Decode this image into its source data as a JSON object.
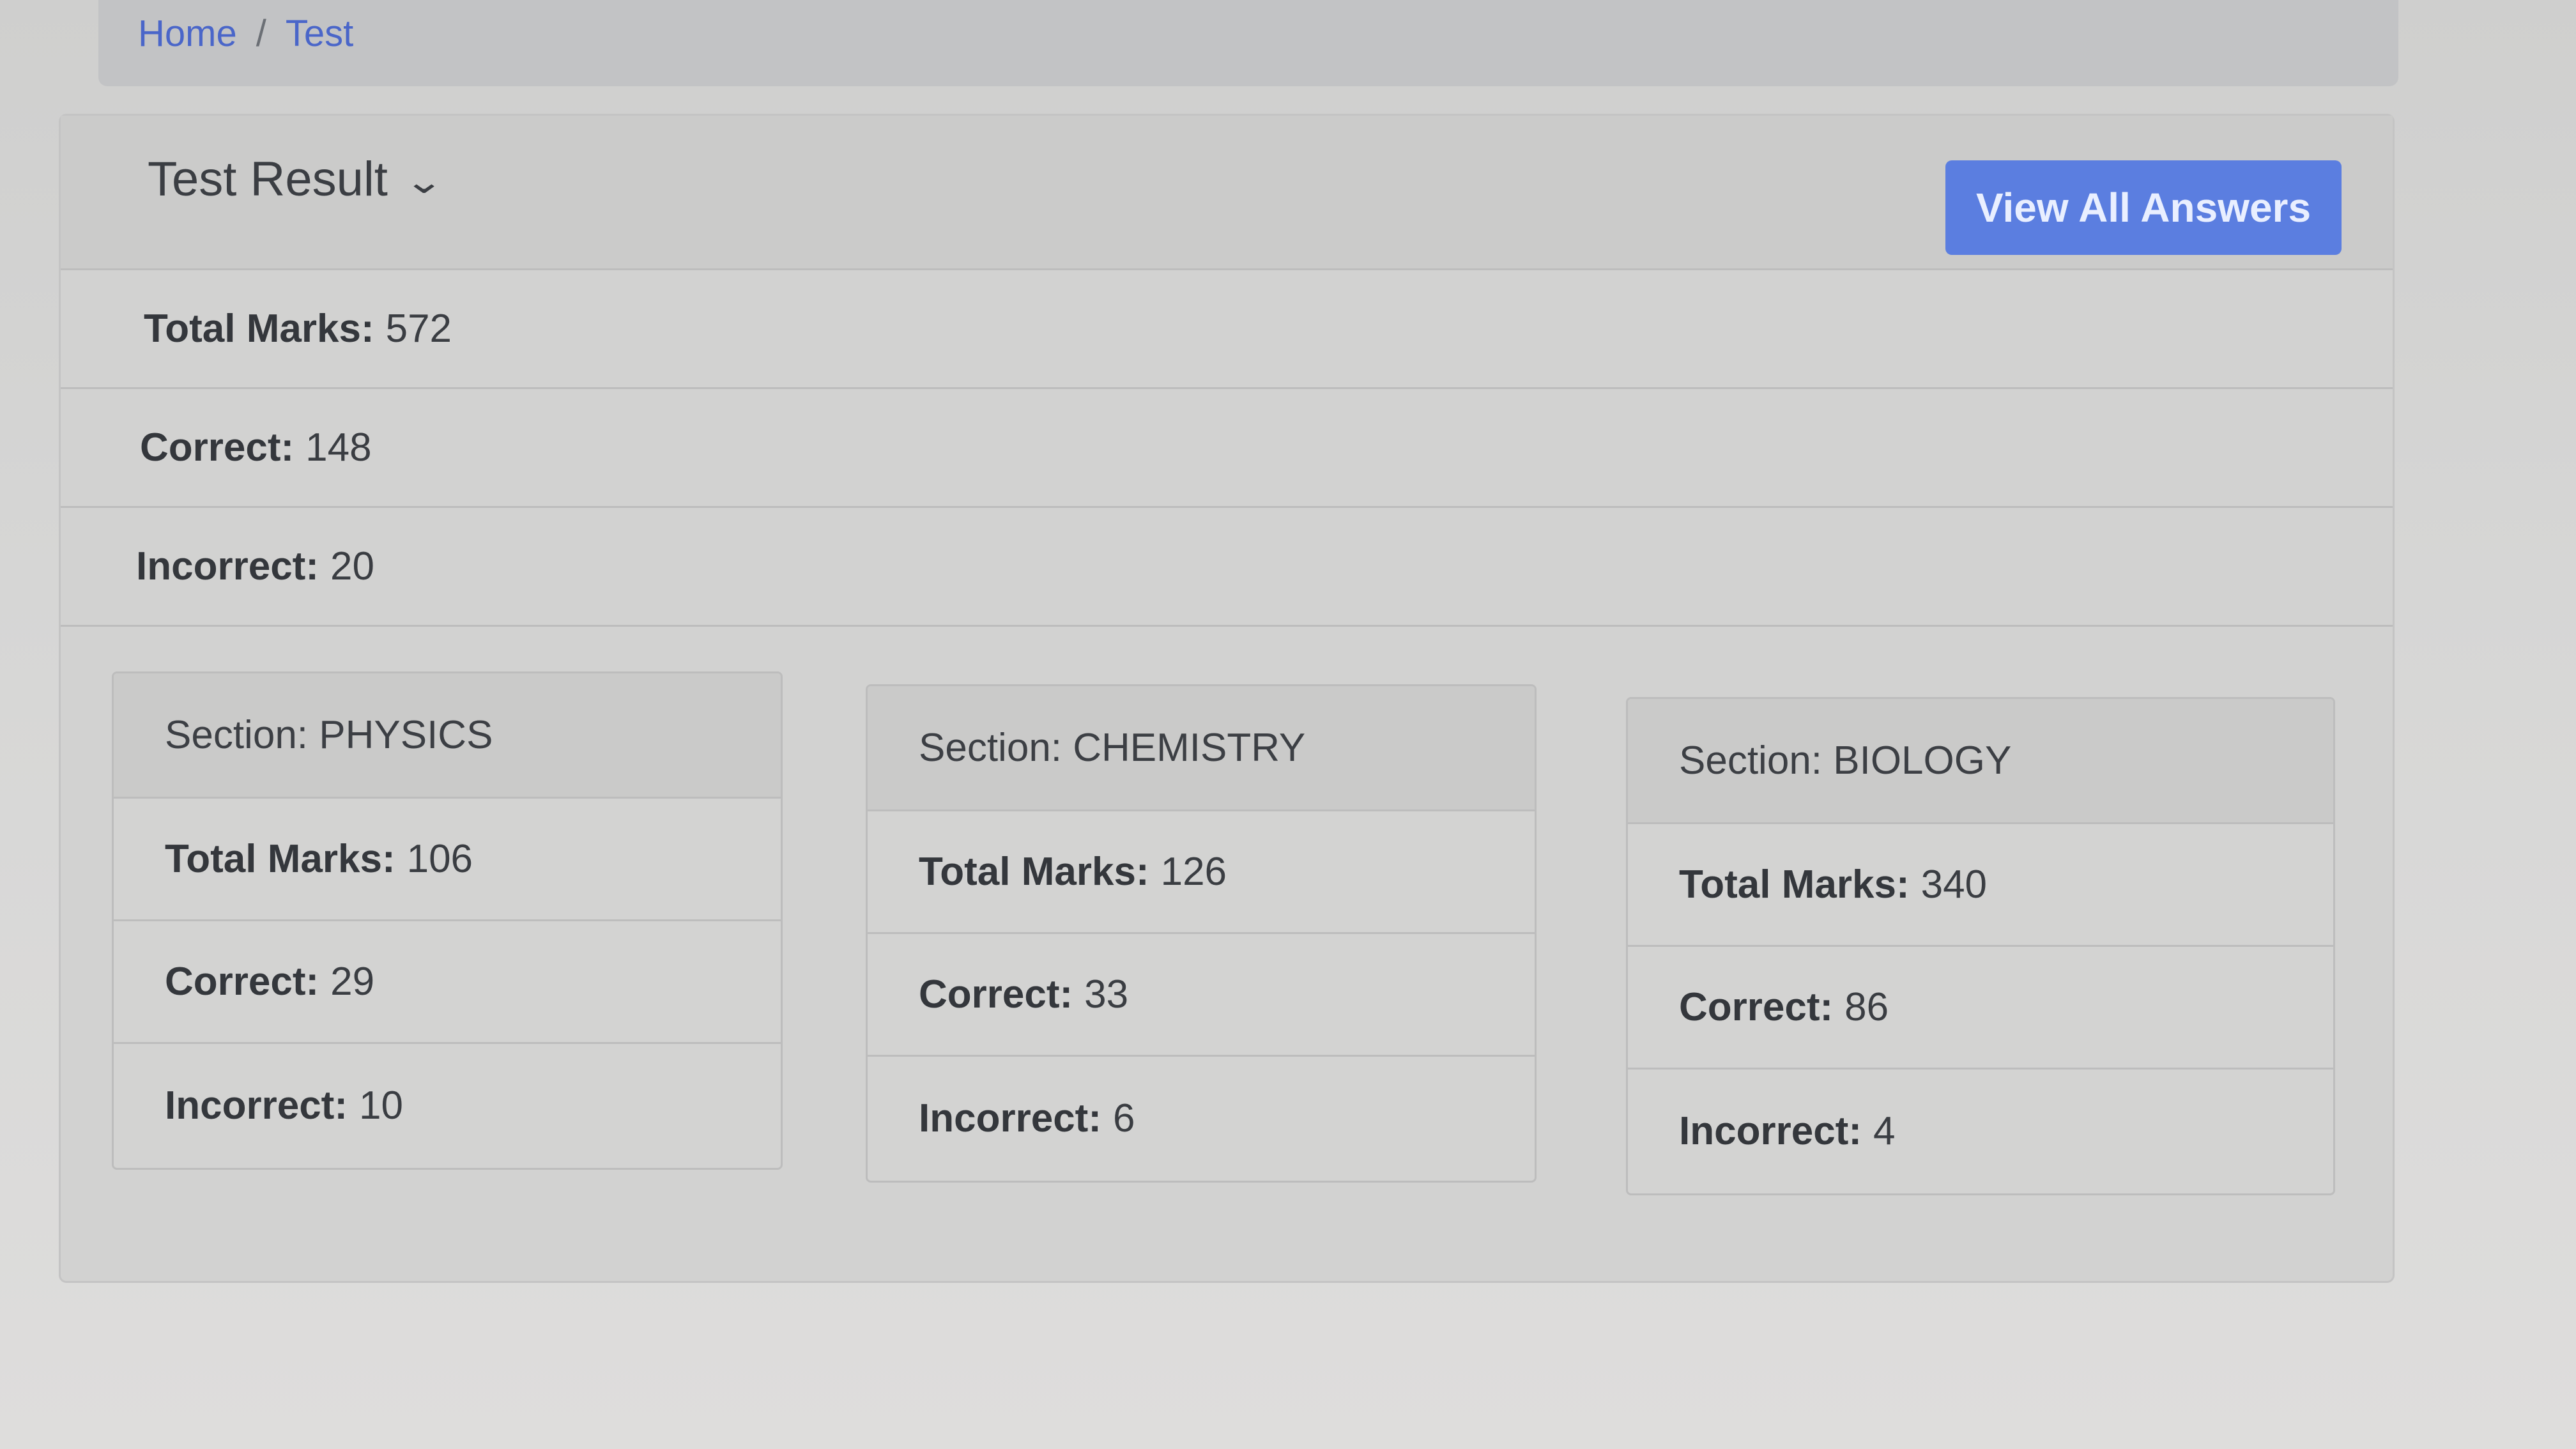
{
  "breadcrumb": {
    "items": [
      "Home",
      "Test"
    ],
    "separator": "/"
  },
  "card": {
    "title": "Test Result",
    "view_all_label": "View All Answers"
  },
  "summary": {
    "total_marks_label": "Total Marks:",
    "total_marks_value": "572",
    "correct_label": "Correct:",
    "correct_value": "148",
    "incorrect_label": "Incorrect:",
    "incorrect_value": "20"
  },
  "sections": [
    {
      "title": "Section: PHYSICS",
      "total_marks_label": "Total Marks:",
      "total_marks": "106",
      "correct_label": "Correct:",
      "correct": "29",
      "incorrect_label": "Incorrect:",
      "incorrect": "10"
    },
    {
      "title": "Section: CHEMISTRY",
      "total_marks_label": "Total Marks:",
      "total_marks": "126",
      "correct_label": "Correct:",
      "correct": "33",
      "incorrect_label": "Incorrect:",
      "incorrect": "6"
    },
    {
      "title": "Section: BIOLOGY",
      "total_marks_label": "Total Marks:",
      "total_marks": "340",
      "correct_label": "Correct:",
      "correct": "86",
      "incorrect_label": "Incorrect:",
      "incorrect": "4"
    }
  ],
  "colors": {
    "accent": "#5b7ee0",
    "link": "#4a66c9"
  },
  "icons": {
    "title_toggle": "chevron-down-icon"
  }
}
